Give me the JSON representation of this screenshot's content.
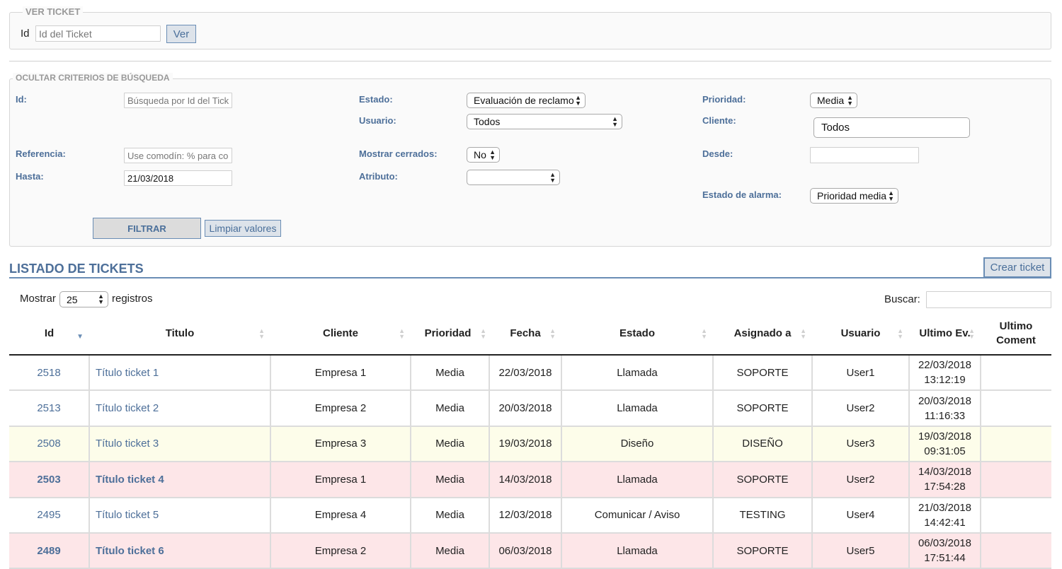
{
  "ver_ticket": {
    "legend": "VER TICKET",
    "id_label": "Id",
    "id_placeholder": "Id del Ticket",
    "ver_button": "Ver"
  },
  "search": {
    "legend": "OCULTAR CRITERIOS DE BÚSQUEDA",
    "labels": {
      "id": "Id:",
      "referencia": "Referencia:",
      "hasta": "Hasta:",
      "estado": "Estado:",
      "usuario": "Usuario:",
      "mostrar_cerrados": "Mostrar cerrados:",
      "atributo": "Atributo:",
      "prioridad": "Prioridad:",
      "cliente": "Cliente:",
      "desde": "Desde:",
      "estado_alarma": "Estado de alarma:"
    },
    "id_placeholder": "Búsqueda por Id del Ticket",
    "referencia_placeholder": "Use comodín: % para comodín",
    "hasta_value": "21/03/2018",
    "desde_value": "",
    "estado_value": "Evaluación de reclamo",
    "usuario_value": "Todos",
    "mostrar_cerrados_value": "No",
    "atributo_value": "",
    "prioridad_value": "Media",
    "cliente_value": "Todos",
    "estado_alarma_value": "Prioridad media",
    "filtrar_button": "FILTRAR",
    "limpiar_button": "Limpiar valores"
  },
  "listado": {
    "title": "LISTADO DE TICKETS",
    "crear_button": "Crear ticket",
    "mostrar_label": "Mostrar",
    "page_size": "25",
    "registros_label": "registros",
    "buscar_label": "Buscar:",
    "columns": [
      "Id",
      "Titulo",
      "Cliente",
      "Prioridad",
      "Fecha",
      "Estado",
      "Asignado a",
      "Usuario",
      "Ultimo Ev.",
      "Ultimo Coment"
    ],
    "rows": [
      {
        "id": "2518",
        "titulo": "Título ticket 1",
        "cliente": "Empresa 1",
        "prioridad": "Media",
        "fecha": "22/03/2018",
        "estado": "Llamada",
        "asignado": "SOPORTE",
        "usuario": "User1",
        "ultimo_ev_fecha": "22/03/2018",
        "ultimo_ev_hora": "13:12:19",
        "ultimo_coment": "",
        "style": "normal"
      },
      {
        "id": "2513",
        "titulo": "Título ticket 2",
        "cliente": "Empresa 2",
        "prioridad": "Media",
        "fecha": "20/03/2018",
        "estado": "Llamada",
        "asignado": "SOPORTE",
        "usuario": "User2",
        "ultimo_ev_fecha": "20/03/2018",
        "ultimo_ev_hora": "11:16:33",
        "ultimo_coment": "",
        "style": "normal"
      },
      {
        "id": "2508",
        "titulo": "Título ticket 3",
        "cliente": "Empresa 3",
        "prioridad": "Media",
        "fecha": "19/03/2018",
        "estado": "Diseño",
        "asignado": "DISEÑO",
        "usuario": "User3",
        "ultimo_ev_fecha": "19/03/2018",
        "ultimo_ev_hora": "09:31:05",
        "ultimo_coment": "",
        "style": "yellow"
      },
      {
        "id": "2503",
        "titulo": "Título ticket 4",
        "cliente": "Empresa 1",
        "prioridad": "Media",
        "fecha": "14/03/2018",
        "estado": "Llamada",
        "asignado": "SOPORTE",
        "usuario": "User2",
        "ultimo_ev_fecha": "14/03/2018",
        "ultimo_ev_hora": "17:54:28",
        "ultimo_coment": "",
        "style": "red"
      },
      {
        "id": "2495",
        "titulo": "Título ticket 5",
        "cliente": "Empresa 4",
        "prioridad": "Media",
        "fecha": "12/03/2018",
        "estado": "Comunicar / Aviso",
        "asignado": "TESTING",
        "usuario": "User4",
        "ultimo_ev_fecha": "21/03/2018",
        "ultimo_ev_hora": "14:42:41",
        "ultimo_coment": "",
        "style": "normal"
      },
      {
        "id": "2489",
        "titulo": "Título ticket 6",
        "cliente": "Empresa 2",
        "prioridad": "Media",
        "fecha": "06/03/2018",
        "estado": "Llamada",
        "asignado": "SOPORTE",
        "usuario": "User5",
        "ultimo_ev_fecha": "06/03/2018",
        "ultimo_ev_hora": "17:51:44",
        "ultimo_coment": "",
        "style": "red"
      }
    ]
  }
}
